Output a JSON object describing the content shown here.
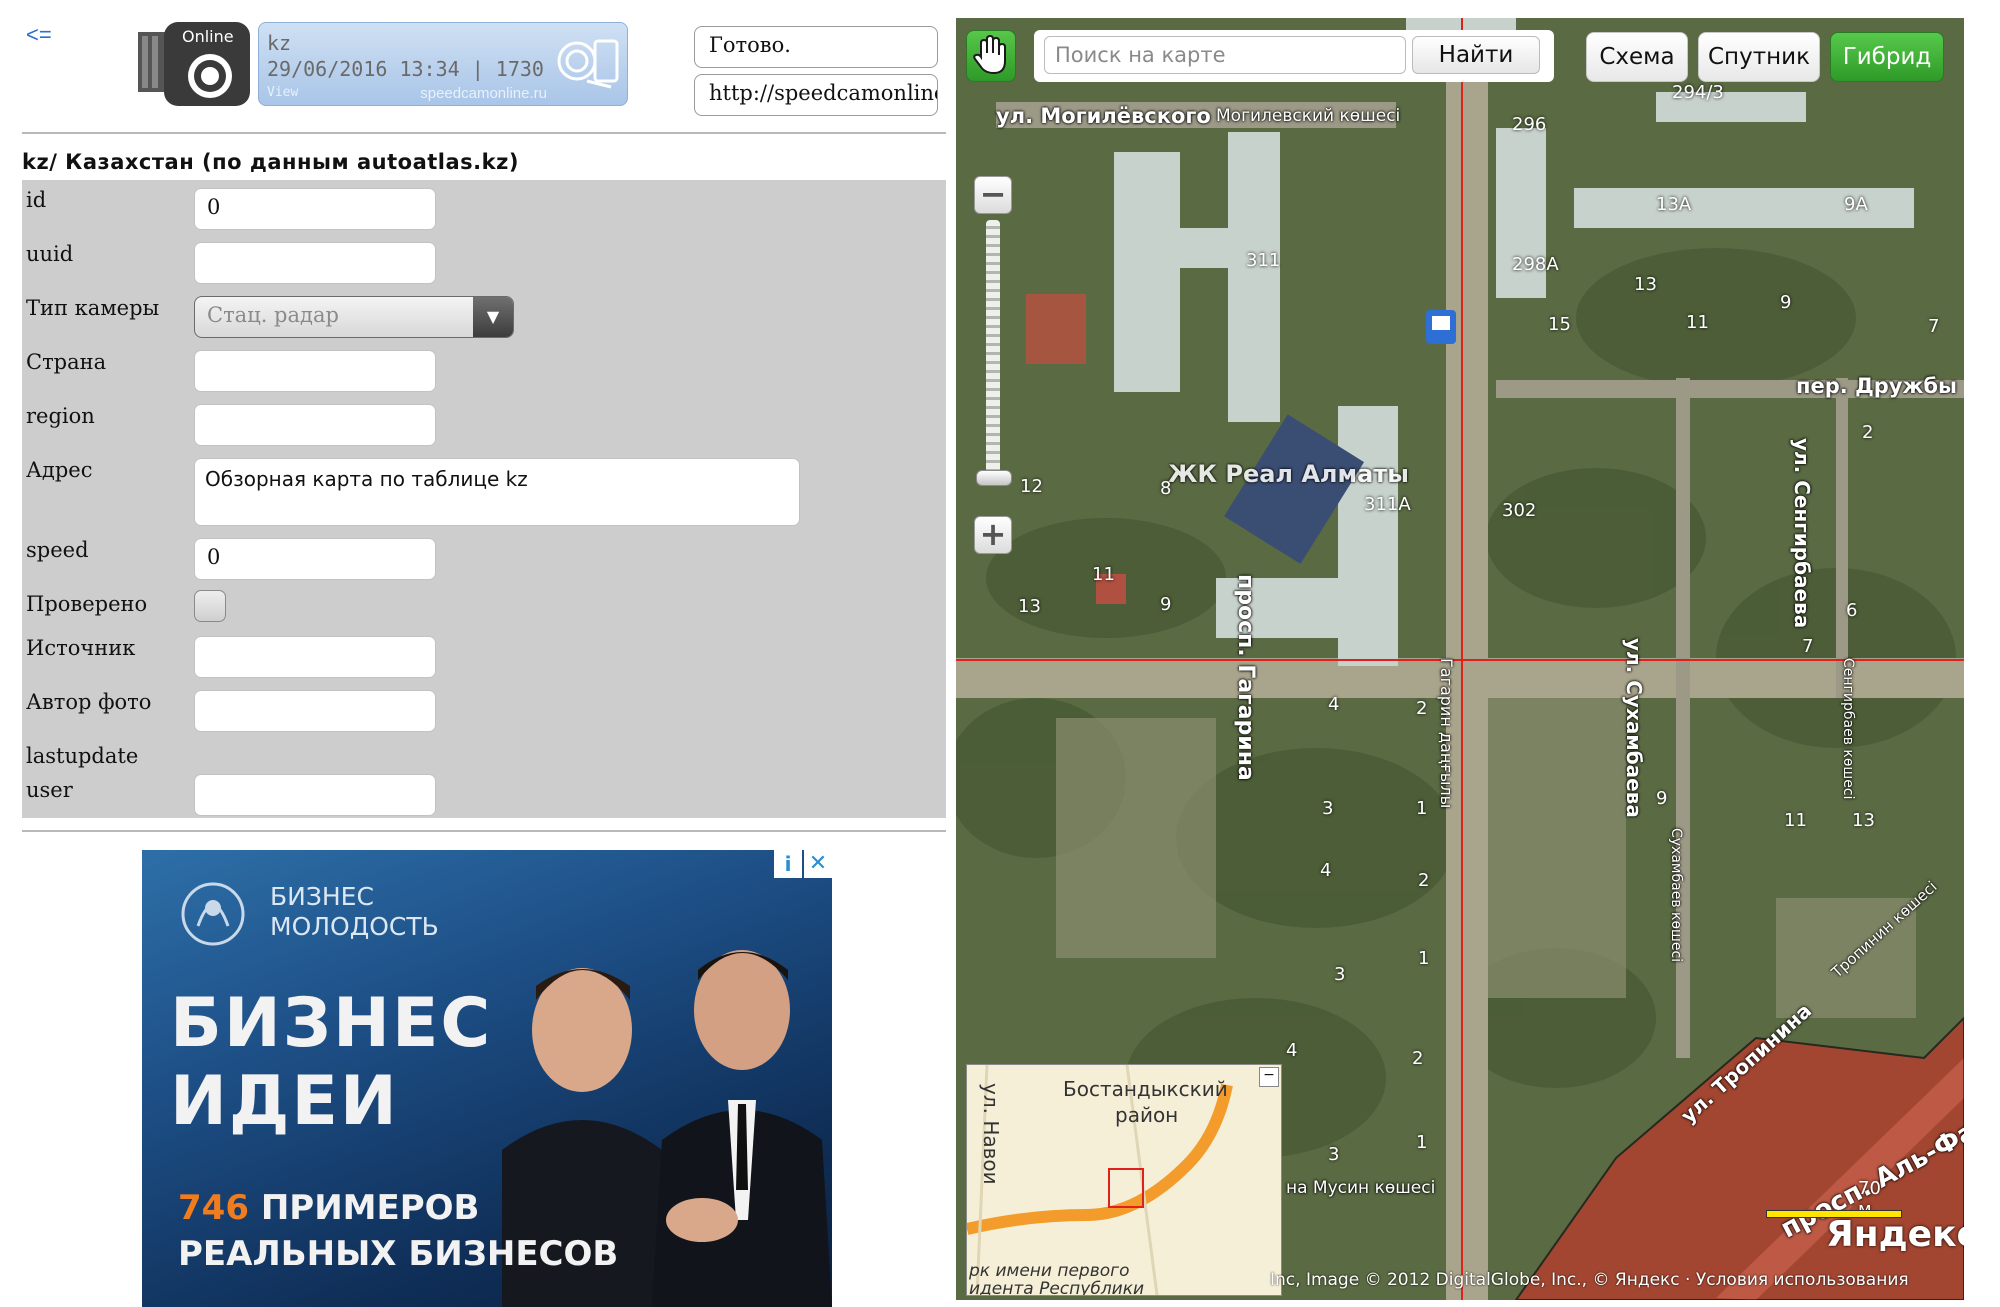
{
  "header": {
    "back_link": "<=",
    "logo_text": "Online",
    "ticker": {
      "line1": "kz",
      "line2": "29/06/2016 13:34 | 1730",
      "line3": "View",
      "site": "speedcamonline.ru"
    },
    "status": "Готово.",
    "url": "http://speedcamonline.ru"
  },
  "form": {
    "title": "kz/ Казахстан (по данным autoatlas.kz)",
    "fields": {
      "id": {
        "label": "id",
        "value": "0"
      },
      "uuid": {
        "label": "uuid",
        "value": ""
      },
      "camera_type": {
        "label": "Тип камеры",
        "value": "Стац. радар"
      },
      "country": {
        "label": "Страна",
        "value": ""
      },
      "region": {
        "label": "region",
        "value": ""
      },
      "address": {
        "label": "Адрес",
        "value": "Обзорная карта по таблице kz"
      },
      "speed": {
        "label": "speed",
        "value": "0"
      },
      "verified": {
        "label": "Проверено",
        "checked": false
      },
      "source": {
        "label": "Источник",
        "value": ""
      },
      "photo_author": {
        "label": "Автор фото",
        "value": ""
      },
      "lastupdate": {
        "label": "lastupdate",
        "value": ""
      },
      "user": {
        "label": "user",
        "value": ""
      }
    }
  },
  "ad": {
    "brand_line1": "БИЗНЕС",
    "brand_line2": "МОЛОДОСТЬ",
    "headline1": "БИЗНЕС",
    "headline2": "ИДЕИ",
    "sub_number": "746",
    "sub_line1_rest": " ПРИМЕРОВ",
    "sub_line2": "РЕАЛЬНЫХ БИЗНЕСОВ",
    "info_icon": "i",
    "close_icon": "✕"
  },
  "map": {
    "search_placeholder": "Поиск на карте",
    "search_button": "Найти",
    "modes": [
      {
        "label": "Схема",
        "active": false
      },
      {
        "label": "Спутник",
        "active": false
      },
      {
        "label": "Гибрид",
        "active": true
      }
    ],
    "zoom_in": "+",
    "zoom_out": "−",
    "labels": {
      "mogilevskogo": "ул. Могилёвского",
      "mogilevskogo_kz": "Могилевский көшесі",
      "druzhby": "пер. Дружбы",
      "gagarina": "просп. Гагарина",
      "gagarina_kz": "Гагарин даңғылы",
      "sukhambaeva": "ул. Сухамбаева",
      "sukhambaeva_kz": "Сухамбаев көшесі",
      "sengirbaeva": "ул. Сенгирбаева",
      "sengirbaeva_kz": "Сенгирбаев көшесі",
      "tropinina": "ул. Тропинина",
      "tropinina_kz": "Тропинин көшесі",
      "alfarabi": "просп. Аль-Фараби",
      "zhk": "ЖК Реал Алматы",
      "musina": "на Мусин көшесі"
    },
    "house_numbers": [
      "294/3",
      "296",
      "13А",
      "9А",
      "298А",
      "311",
      "13",
      "9",
      "15",
      "11",
      "7",
      "311А",
      "302",
      "8",
      "12",
      "11",
      "9",
      "13",
      "4",
      "2",
      "3",
      "1",
      "4",
      "2",
      "1",
      "3",
      "4",
      "2",
      "9",
      "11",
      "13",
      "6",
      "7",
      "2",
      "1",
      "3"
    ],
    "minimap": {
      "district": "Бостандыкский",
      "district2": "район",
      "street": "ул. Навои",
      "park": "рк имени первого",
      "park2": "идента Республики",
      "minimize": "−"
    },
    "scale_label": "70 м",
    "brand": "Яндекс",
    "copyright": "Inc, Image © 2012 DigitalGlobe, Inc., © Яндекс · Условия использования"
  }
}
